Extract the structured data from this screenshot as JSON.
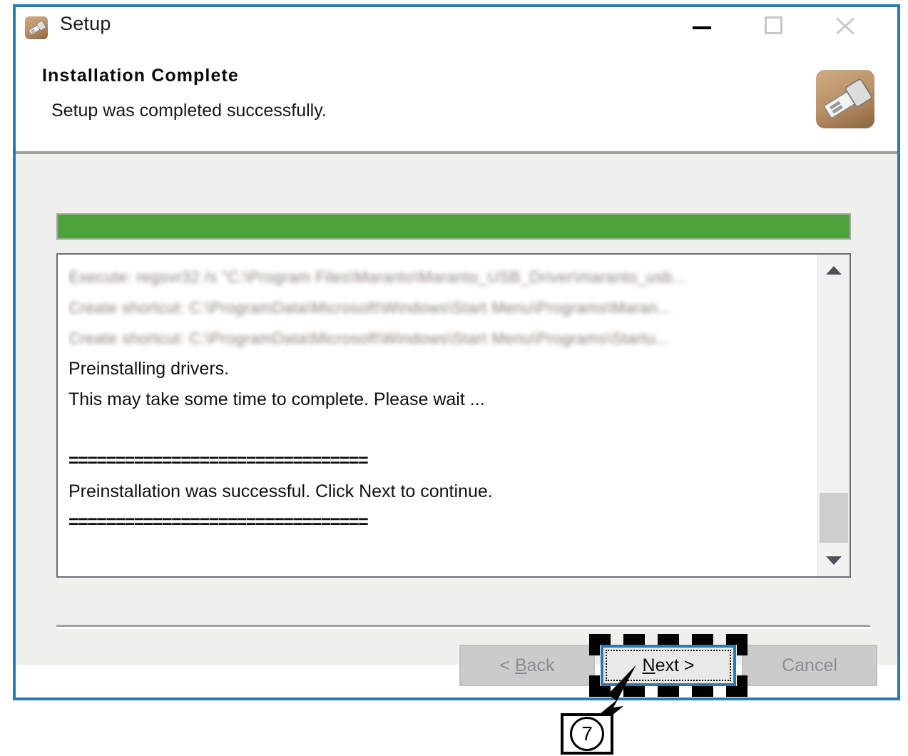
{
  "window": {
    "title": "Setup",
    "icon": "usb-drive-icon",
    "border_color": "#2a7ab0",
    "controls": {
      "minimize": {
        "label": "Minimize",
        "icon": "minimize-icon"
      },
      "maximize": {
        "label": "Maximize",
        "icon": "maximize-icon"
      },
      "close": {
        "label": "Close",
        "icon": "close-icon"
      }
    }
  },
  "header": {
    "heading": "Installation Complete",
    "subtext": "Setup was completed successfully.",
    "logo_icon": "usb-drive-icon"
  },
  "progress": {
    "percent": 100,
    "fill_color": "#4da23c",
    "border_color": "#a6a6a6"
  },
  "log": {
    "lines": [
      {
        "text": "Execute: regsvr32 /s \"C:\\Program Files\\Maranto\\Maranto_USB_Driver\\maranto_usb...",
        "blurred": true
      },
      {
        "text": "Create shortcut: C:\\ProgramData\\Microsoft\\Windows\\Start Menu\\Programs\\Maran...",
        "blurred": true
      },
      {
        "text": "Create shortcut: C:\\ProgramData\\Microsoft\\Windows\\Start Menu\\Programs\\Startu...",
        "blurred": true
      },
      {
        "text": "Preinstalling drivers.",
        "blurred": false
      },
      {
        "text": "This may take some time to complete. Please wait ...",
        "blurred": false
      },
      {
        "text": "",
        "blurred": false
      },
      {
        "text": "================================",
        "blurred": false
      },
      {
        "text": "Preinstallation was successful. Click Next to continue.",
        "blurred": false
      },
      {
        "text": "================================",
        "blurred": false
      }
    ],
    "scrollbar": {
      "up_icon": "chevron-up-icon",
      "down_icon": "chevron-down-icon"
    }
  },
  "buttons": {
    "back": {
      "label": "< Back",
      "accel": "B",
      "disabled": true
    },
    "next": {
      "label": "Next >",
      "accel": "N",
      "disabled": false,
      "focused": true
    },
    "cancel": {
      "label": "Cancel",
      "accel": "",
      "disabled": true
    }
  },
  "annotation": {
    "step_number": "7",
    "target": "next-button",
    "highlight_color": "#000000"
  }
}
